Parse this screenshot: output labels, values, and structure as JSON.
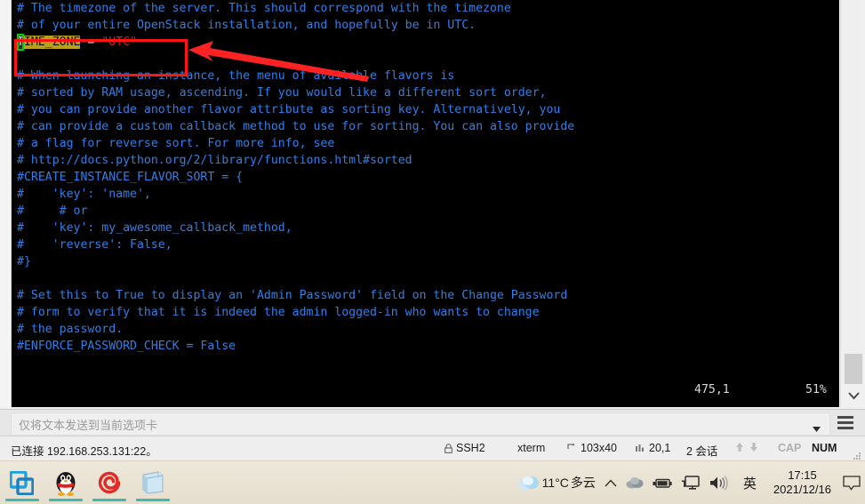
{
  "terminal": {
    "lines": [
      {
        "parts": [
          {
            "t": "# The timezone of the server. This should correspond with the timezone",
            "c": "cm"
          }
        ]
      },
      {
        "parts": [
          {
            "t": "# of your entire OpenStack installation, and hopefully be in UTC.",
            "c": "cm"
          }
        ]
      },
      {
        "special": "timezone",
        "parts": [
          {
            "t": "T",
            "c": "cursor"
          },
          {
            "t": "IME_ZONE",
            "c": "hl"
          },
          {
            "t": " = ",
            "c": "op"
          },
          {
            "t": "\"UTC\"",
            "c": "str"
          }
        ]
      },
      {
        "parts": [
          {
            "t": "",
            "c": "cm"
          }
        ]
      },
      {
        "parts": [
          {
            "t": "# When launching an instance, the menu of available flavors is",
            "c": "cm"
          }
        ]
      },
      {
        "parts": [
          {
            "t": "# sorted by RAM usage, ascending. If you would like a different sort order,",
            "c": "cm"
          }
        ]
      },
      {
        "parts": [
          {
            "t": "# you can provide another flavor attribute as sorting key. Alternatively, you",
            "c": "cm"
          }
        ]
      },
      {
        "parts": [
          {
            "t": "# can provide a custom callback method to use for sorting. You can also provide",
            "c": "cm"
          }
        ]
      },
      {
        "parts": [
          {
            "t": "# a flag for reverse sort. For more info, see",
            "c": "cm"
          }
        ]
      },
      {
        "parts": [
          {
            "t": "# http://docs.python.org/2/library/functions.html#sorted",
            "c": "cm"
          }
        ]
      },
      {
        "parts": [
          {
            "t": "#CREATE_INSTANCE_FLAVOR_SORT = {",
            "c": "cm"
          }
        ]
      },
      {
        "parts": [
          {
            "t": "#    'key': 'name',",
            "c": "cm"
          }
        ]
      },
      {
        "parts": [
          {
            "t": "#     # or",
            "c": "cm"
          }
        ]
      },
      {
        "parts": [
          {
            "t": "#    'key': my_awesome_callback_method,",
            "c": "cm"
          }
        ]
      },
      {
        "parts": [
          {
            "t": "#    'reverse': False,",
            "c": "cm"
          }
        ]
      },
      {
        "parts": [
          {
            "t": "#}",
            "c": "cm"
          }
        ]
      },
      {
        "parts": [
          {
            "t": "",
            "c": "cm"
          }
        ]
      },
      {
        "parts": [
          {
            "t": "# Set this to True to display an 'Admin Password' field on the Change Password",
            "c": "cm"
          }
        ]
      },
      {
        "parts": [
          {
            "t": "# form to verify that it is indeed the admin logged-in who wants to change",
            "c": "cm"
          }
        ]
      },
      {
        "parts": [
          {
            "t": "# the password.",
            "c": "cm"
          }
        ]
      },
      {
        "parts": [
          {
            "t": "#ENFORCE_PASSWORD_CHECK = False",
            "c": "cm"
          }
        ]
      }
    ],
    "status": {
      "position": "475,1",
      "percent": "51%"
    },
    "colors": {
      "background": "#000000",
      "comment": "#2f7fe8",
      "string": "#cc2020",
      "highlight_bg": "#b8a018",
      "cursor_outline": "#00d000"
    }
  },
  "annotation": {
    "box_color": "#ff1414",
    "arrow_color": "#ff2222"
  },
  "sendbar": {
    "placeholder": "仅将文本发送到当前选项卡",
    "value": "",
    "dropdown_icon": "chevron-down-icon",
    "menu_icon": "hamburger-menu-icon"
  },
  "statusbar": {
    "connection": "已连接 192.168.253.131:22。",
    "protocol": "SSH2",
    "emulation": "xterm",
    "size": "103x40",
    "cursor": "20,1",
    "sessions": "2 会话",
    "cap": "CAP",
    "num": "NUM"
  },
  "taskbar": {
    "items": [
      {
        "name": "vmware-workstation",
        "label": "VMware Workstation"
      },
      {
        "name": "qq-messenger",
        "label": "QQ"
      },
      {
        "name": "xshell",
        "label": "Xshell"
      },
      {
        "name": "notepad-editor",
        "label": "Notepad"
      }
    ],
    "tray": {
      "weather_icon": "cloud-icon",
      "temperature": "11°C",
      "condition": "多云",
      "overflow_icon": "chevron-up-icon",
      "onedrive_icon": "cloud-sync-icon",
      "battery_icon": "battery-icon",
      "network_icon": "monitor-network-icon",
      "volume_icon": "speaker-icon",
      "ime": "英",
      "time": "17:15",
      "date": "2021/12/16",
      "notification_icon": "notification-icon"
    }
  }
}
